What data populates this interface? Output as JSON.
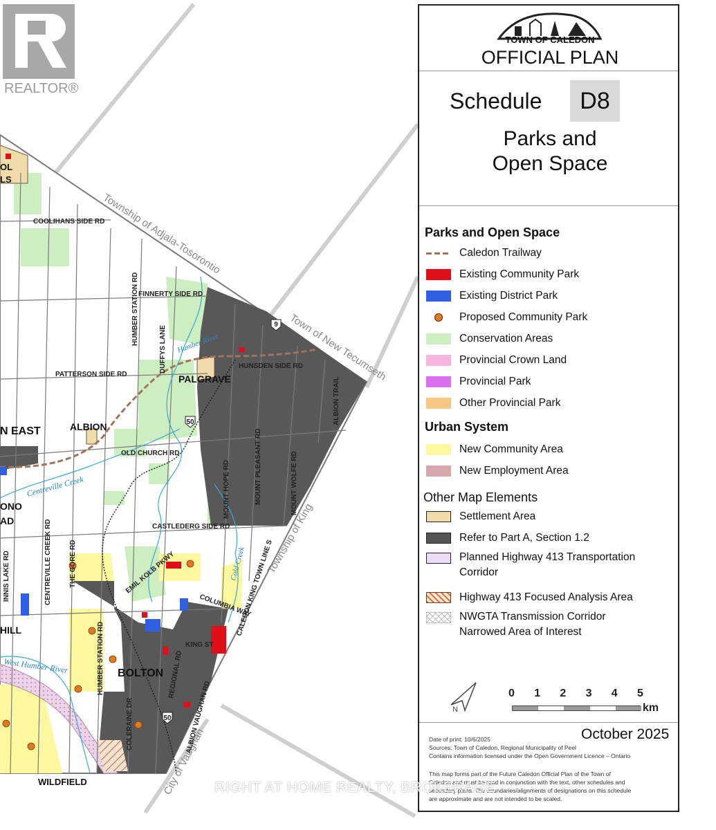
{
  "brand": {
    "realtor": "REALTOR®"
  },
  "title_block": {
    "town": "TOWN OF CALEDON",
    "plan": "OFFICIAL PLAN",
    "schedule_word": "Schedule",
    "schedule_code": "D8",
    "schedule_title_line1": "Parks and",
    "schedule_title_line2": "Open Space"
  },
  "legend": {
    "parks_heading": "Parks and Open Space",
    "parks_items": [
      {
        "label": "Caledon Trailway",
        "symbol": "dashed-line",
        "color": "#a0745a"
      },
      {
        "label": "Existing Community Park",
        "symbol": "fill",
        "color": "#e0101a"
      },
      {
        "label": "Existing District Park",
        "symbol": "fill",
        "color": "#3060e0"
      },
      {
        "label": "Proposed Community Park",
        "symbol": "dot",
        "color": "#e07a20"
      },
      {
        "label": "Conservation Areas",
        "symbol": "fill",
        "color": "#cdeec0"
      },
      {
        "label": "Provincial Crown Land",
        "symbol": "fill",
        "color": "#f7b6dd"
      },
      {
        "label": "Provincial Park",
        "symbol": "fill",
        "color": "#da6ff0"
      },
      {
        "label": "Other Provincial Park",
        "symbol": "fill",
        "color": "#f8c783"
      }
    ],
    "urban_heading": "Urban System",
    "urban_items": [
      {
        "label": "New Community Area",
        "symbol": "fill",
        "color": "#fbf8a0"
      },
      {
        "label": "New Employment Area",
        "symbol": "fill",
        "color": "#d7a8ab"
      }
    ],
    "other_heading": "Other Map Elements",
    "other_items": [
      {
        "label": "Settlement Area",
        "symbol": "fill-outline",
        "color": "#efdcaa"
      },
      {
        "label": "Refer to Part A, Section 1.2",
        "symbol": "fill-outline",
        "color": "#555555"
      },
      {
        "label": "Planned Highway 413 Transportation",
        "label2": "Corridor",
        "symbol": "fill-outline",
        "color": "#ecdcf7"
      },
      {
        "label": "Highway 413 Focused Analysis Area",
        "symbol": "hatch",
        "color": "#d07a40"
      },
      {
        "label": "NWGTA Transmission Corridor",
        "label2": "Narrowed Area of Interest",
        "symbol": "cross-hatch",
        "color": "#999999"
      }
    ]
  },
  "scale": {
    "ticks": [
      "0",
      "1",
      "2",
      "3",
      "4",
      "5"
    ],
    "unit": "km"
  },
  "footer": {
    "date_label": "Date of print: 10/6/2025",
    "sources": "Sources: Town of Caledon, Regional Municipality of Peel",
    "licence": "Contains information licensed under the Open Government Licence – Ontario",
    "date_big": "October 2025",
    "note1": "This map forms part of the Future Caledon Official Plan of the Town of",
    "note2": "Caledon and must be read in conjunction with the text, other schedules and",
    "note3": "secondary plans. The boundaries/alignments of designations on this schedule",
    "note4": "are approximate and are not intended to be scaled."
  },
  "watermark": "RIGHT AT HOME REALTY, BROKERAGE",
  "map": {
    "boundary_labels": [
      "Township of Adjala-Tosorontio",
      "Town of New Tecumseth",
      "Township of King",
      "City of Vaughan"
    ],
    "roads": [
      "COOLIHANS SIDE RD",
      "FINNERTY SIDE RD",
      "PATTERSON SIDE RD",
      "HUNSDEN SIDE RD",
      "OLD CHURCH RD",
      "CASTLEDERG SIDE RD",
      "HUMBER STATION RD",
      "DUFFYS LANE",
      "MOUNT HOPE RD",
      "MOUNT PLEASANT RD",
      "MOUNT WOLFE RD",
      "ALBION TRAIL",
      "KING ST",
      "COLUMBIA WAY",
      "EMIL KOLB PKWY",
      "HUMBER STATION RD",
      "THE GORE RD",
      "CENTREVILLE CREEK RD",
      "INNIS LAKE RD",
      "COLERAINE DR",
      "ALBION VAUGHAN RD",
      "REGIONAL RD",
      "CALEDON KING TOWN LINE S"
    ],
    "places": [
      "PALGRAVE",
      "ALBION",
      "N EAST",
      "BOLTON",
      "WILDFIELD",
      "HILL",
      "ONO",
      "AD",
      "OL",
      "LS"
    ],
    "rivers": [
      "Humber River",
      "Centreville Creek",
      "Cold Creek",
      "West Humber River"
    ],
    "highways": [
      "9",
      "50",
      "50"
    ]
  }
}
